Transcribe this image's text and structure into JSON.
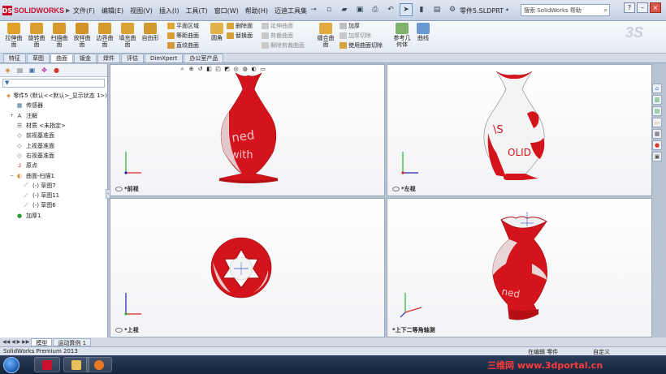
{
  "app": {
    "logo_text": "SOLIDWORKS",
    "menu": [
      "文件(F)",
      "编辑(E)",
      "视图(V)",
      "插入(I)",
      "工具(T)",
      "窗口(W)",
      "帮助(H)",
      "迈迪工具集"
    ],
    "doc_title": "零件5.SLDPRT *",
    "search_placeholder": "搜索 SolidWorks 帮助",
    "ribbon_logo": "3S"
  },
  "ribbon": {
    "large_buttons": [
      {
        "label": "拉伸曲面",
        "color": "#e0a02a"
      },
      {
        "label": "旋转曲面",
        "color": "#d9a030"
      },
      {
        "label": "扫描曲面",
        "color": "#d89a2c"
      },
      {
        "label": "放样曲面",
        "color": "#d29428"
      },
      {
        "label": "边界曲面",
        "color": "#d69a2e"
      },
      {
        "label": "填充曲面",
        "color": "#dba234"
      },
      {
        "label": "自由形",
        "color": "#cf9a2f"
      }
    ],
    "small_col1": [
      "平面区域",
      "等距曲面",
      "直纹曲面"
    ],
    "fillet_label": "圆角",
    "small_col2": [
      "删除面",
      "替换面"
    ],
    "small_col3": [
      "延伸曲面",
      "剪裁曲面",
      "解除剪裁曲面"
    ],
    "knit_label": "缝合曲面",
    "small_col4": [
      "加厚",
      "加厚切除",
      "使用曲面切除"
    ],
    "ref_geom_label": "参考几何体",
    "curves_label": "曲线"
  },
  "tabs": [
    "特征",
    "草图",
    "曲面",
    "钣金",
    "焊件",
    "评估",
    "DimXpert",
    "办公室产品"
  ],
  "active_tab": 2,
  "tree": {
    "items": [
      {
        "label": "零件5  (默认<<默认>_显示状态 1>)",
        "icon": "part-icon",
        "indent": 0,
        "expand": ""
      },
      {
        "label": "传感器",
        "icon": "sensor-icon",
        "indent": 1,
        "expand": ""
      },
      {
        "label": "注解",
        "icon": "annotation-icon",
        "indent": 1,
        "expand": "+"
      },
      {
        "label": "材质 <未指定>",
        "icon": "material-icon",
        "indent": 1,
        "expand": ""
      },
      {
        "label": "前视基准面",
        "icon": "plane-icon",
        "indent": 1,
        "expand": ""
      },
      {
        "label": "上视基准面",
        "icon": "plane-icon",
        "indent": 1,
        "expand": ""
      },
      {
        "label": "右视基准面",
        "icon": "plane-icon",
        "indent": 1,
        "expand": ""
      },
      {
        "label": "原点",
        "icon": "origin-icon",
        "indent": 1,
        "expand": ""
      },
      {
        "label": "曲面-扫描1",
        "icon": "sweep-surface-icon",
        "indent": 1,
        "expand": "−"
      },
      {
        "label": "(-) 草图7",
        "icon": "sketch-icon",
        "indent": 2,
        "expand": ""
      },
      {
        "label": "(-) 草图11",
        "icon": "sketch-icon",
        "indent": 2,
        "expand": ""
      },
      {
        "label": "(-) 草图6",
        "icon": "sketch-icon",
        "indent": 2,
        "expand": ""
      },
      {
        "label": "加厚1",
        "icon": "thicken-icon",
        "indent": 1,
        "expand": ""
      }
    ]
  },
  "viewports": {
    "front": {
      "label": "*前视"
    },
    "left": {
      "label": "*左视"
    },
    "top": {
      "label": "*上视"
    },
    "iso": {
      "label": "*上下二等角轴测"
    }
  },
  "bottom_tabs": [
    "模型",
    "运动算例 1"
  ],
  "status": {
    "product": "SolidWorks Premium 2013",
    "editing": "在编辑 零件",
    "units": "自定义"
  },
  "watermark": "三维网 www.3dportal.cn",
  "colors": {
    "vase_red": "#d4141c",
    "brand_red": "#c8102e"
  }
}
